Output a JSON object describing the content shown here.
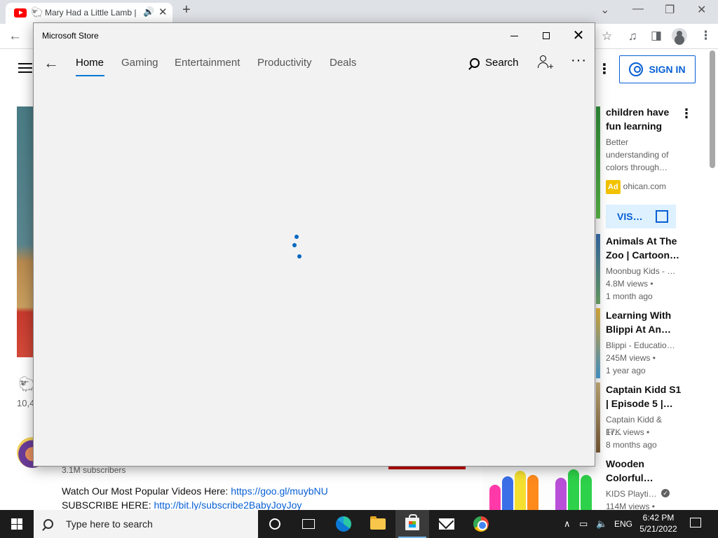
{
  "browser": {
    "tab_title": "Mary Had a Little Lamb |",
    "tab_close": "✕",
    "new_tab": "+",
    "sheep_glyph": "🐑",
    "audio_glyph": "🔊"
  },
  "youtube": {
    "sign_in": "SIGN IN",
    "views_truncated": "10,4",
    "subscribers": "3.1M subscribers",
    "desc_line1_text": "Watch Our Most Popular Videos Here: ",
    "desc_line1_link": "https://goo.gl/muybNU",
    "desc_line2_text": "SUBSCRIBE HERE:  ",
    "desc_line2_link": "http://bit.ly/subscribe2BabyJoyJoy",
    "ad": {
      "title": "children have fun learning",
      "desc": "Better understanding of colors through…",
      "badge": "Ad",
      "domain": "ohican.com",
      "visit": "VIS…"
    },
    "recommendations": [
      {
        "title": "Animals At The Zoo | Cartoon…",
        "channel": "Moonbug Kids - …",
        "views": "4.8M views •",
        "age": "1 month ago"
      },
      {
        "title": "Learning With Blippi At An…",
        "channel": "Blippi - Educatio…",
        "views": "245M views •",
        "age": "1 year ago"
      },
      {
        "title": "Captain Kidd S1 | Episode 5 |…",
        "channel": "Captain Kidd & Fr…",
        "views": "17K views •",
        "age": "8 months ago"
      },
      {
        "title": "Wooden Colorful…",
        "channel": "KIDS Playti…",
        "views": "114M views •"
      }
    ]
  },
  "store": {
    "window_title": "Microsoft Store",
    "tabs": [
      {
        "label": "Home",
        "active": true
      },
      {
        "label": "Gaming",
        "active": false
      },
      {
        "label": "Entertainment",
        "active": false
      },
      {
        "label": "Productivity",
        "active": false
      },
      {
        "label": "Deals",
        "active": false
      }
    ],
    "search_label": "Search",
    "more_label": "···",
    "loading": true
  },
  "taskbar": {
    "search_placeholder": "Type here to search",
    "language": "ENG",
    "time": "6:42 PM",
    "date": "5/21/2022"
  },
  "colors": {
    "store_accent": "#0078d4",
    "spinner": "#0067c0",
    "youtube_link": "#065fd4",
    "youtube_red": "#ff0000"
  }
}
